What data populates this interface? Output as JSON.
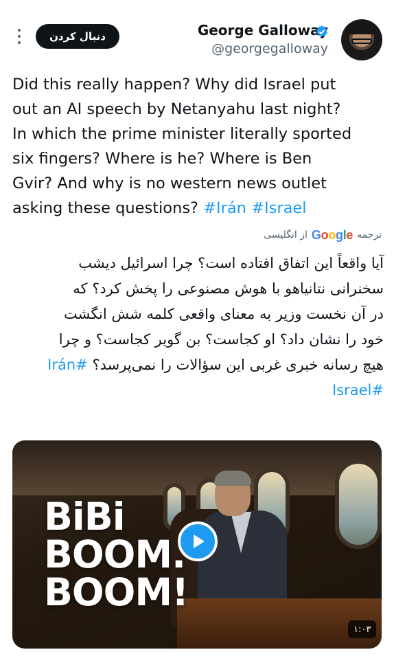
{
  "header": {
    "display_name": "George Galloway",
    "handle": "@georgegalloway",
    "follow_label": "دنبال کردن",
    "verified": true
  },
  "tweet": {
    "text_lines": [
      "Did this really happen? Why did Israel put",
      "out an AI speech by Netanyahu last night?",
      "In which the prime minister literally sported",
      "six fingers? Where is he? Where is Ben",
      "Gvir? And why is no western news outlet"
    ],
    "last_line_text": "asking these questions?",
    "hashtags": [
      "#Irán",
      "#Israel"
    ]
  },
  "translation": {
    "prefix": "ترجمه",
    "provider": "Google",
    "suffix": "از انگلیسی"
  },
  "translated": {
    "lines": [
      "آیا واقعاً این اتفاق افتاده است؟ چرا اسرائیل دیشب",
      "سخنرانی نتانیاهو با هوش مصنوعی را پخش کرد؟ که",
      "در آن نخست وزیر به معنای واقعی کلمه شش انگشت",
      "خود را نشان داد؟ او کجاست؟ بن گویر کجاست؟ و چرا"
    ],
    "last_line_text": "هیچ رسانه خبری غربی این سؤالات را نمی‌پرسد؟",
    "hashtag_1": "#Irán",
    "hashtag_2": "#Israel"
  },
  "media": {
    "overlay_line_1": "BiBi",
    "overlay_line_2": "BOOM.",
    "overlay_line_3": "BOOM!",
    "duration": "۱:۰۳"
  },
  "colors": {
    "accent": "#1d9bf0",
    "text": "#0f1419",
    "secondary": "#536471"
  }
}
